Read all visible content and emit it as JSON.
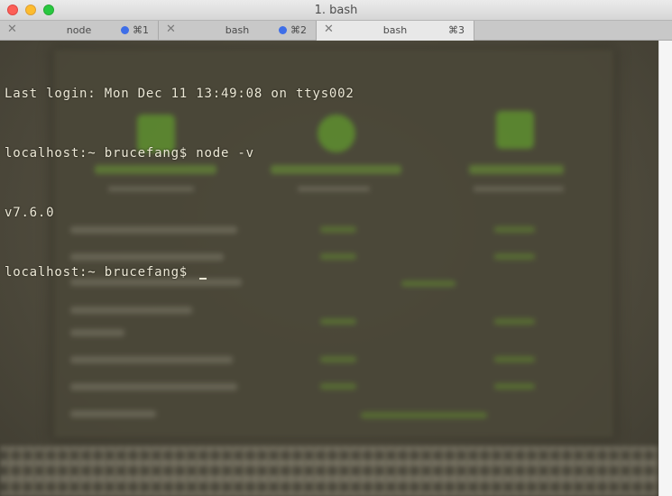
{
  "window": {
    "title": "1. bash"
  },
  "tabs": [
    {
      "label": "node",
      "shortcut": "⌘1",
      "has_activity": true,
      "active": false
    },
    {
      "label": "bash",
      "shortcut": "⌘2",
      "has_activity": true,
      "active": false
    },
    {
      "label": "bash",
      "shortcut": "⌘3",
      "has_activity": false,
      "active": true
    }
  ],
  "terminal": {
    "lines": [
      "Last login: Mon Dec 11 13:49:08 on ttys002",
      "localhost:~ brucefang$ node -v",
      "v7.6.0",
      "localhost:~ brucefang$ "
    ]
  },
  "colors": {
    "text": "#ece8d6",
    "background": "#4e4a3c",
    "activity_dot": "#3e6ee8"
  },
  "icons": {
    "close": "close-icon",
    "minimize": "minimize-icon",
    "zoom": "zoom-icon",
    "tab_close": "x-icon"
  }
}
